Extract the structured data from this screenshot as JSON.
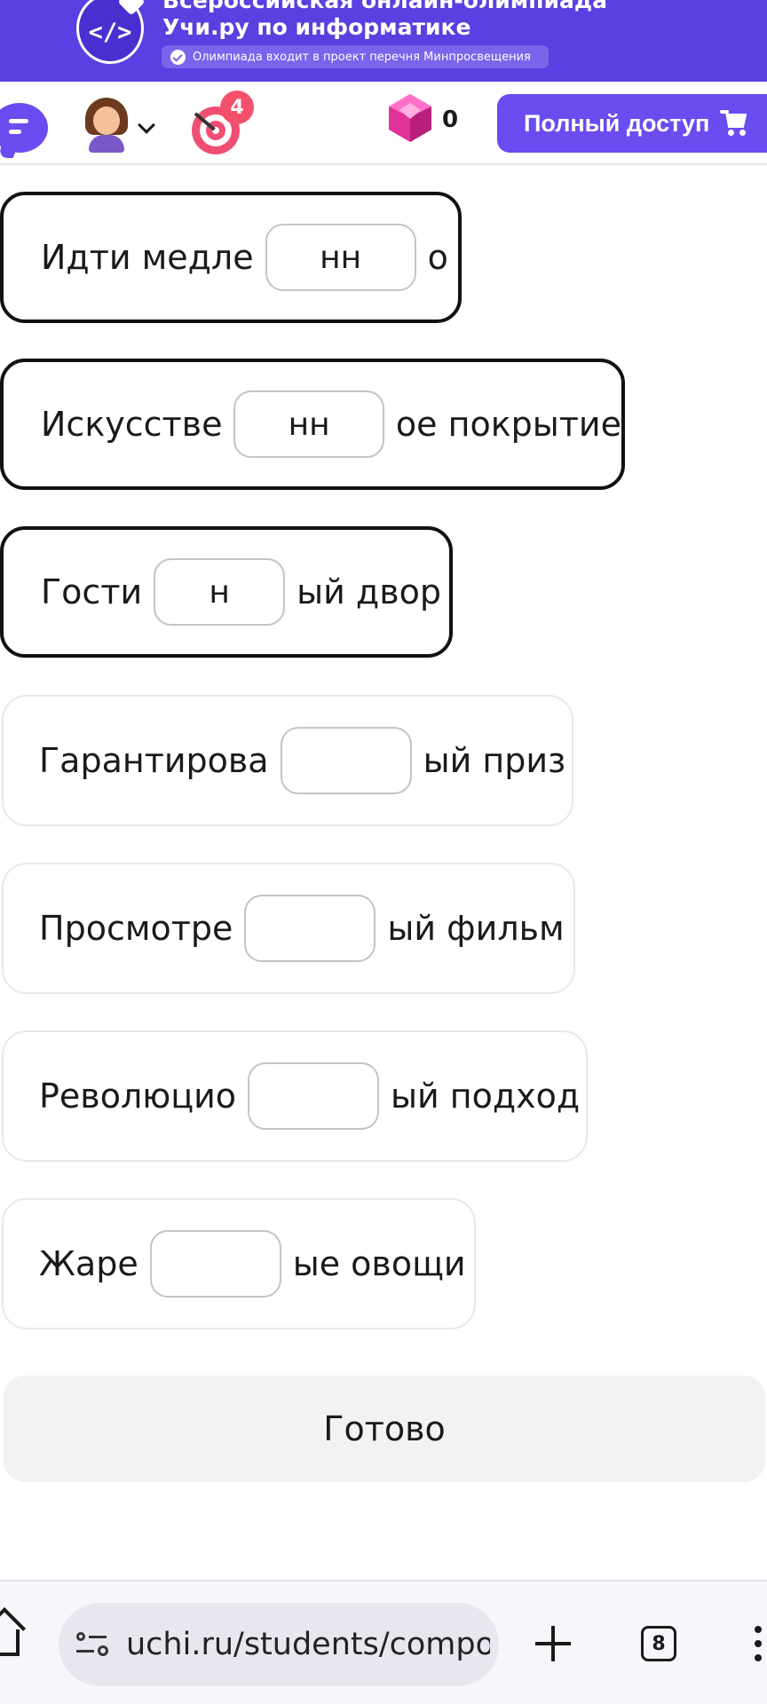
{
  "banner": {
    "title_line1": "Всероссийская онлайн-олимпиада",
    "title_line2": "Учи.ру по информатике",
    "pill_text": "Олимпиада входит в проект перечня Минпросвещения",
    "logo_code": "</>"
  },
  "header": {
    "tasks_badge": "4",
    "gems_count": "0",
    "full_access_label": "Полный доступ"
  },
  "tasks": [
    {
      "before": "Идти медле",
      "answer": "нн",
      "after": "о",
      "state": "answered"
    },
    {
      "before": "Искусстве",
      "answer": "нн",
      "after": "ое покрытие",
      "state": "answered"
    },
    {
      "before": "Гости",
      "answer": "н",
      "after": "ый двор",
      "state": "answered"
    },
    {
      "before": "Гарантирова",
      "answer": "",
      "after": "ый приз",
      "state": "empty"
    },
    {
      "before": "Просмотре",
      "answer": "",
      "after": "ый фильм",
      "state": "empty"
    },
    {
      "before": "Революцио",
      "answer": "",
      "after": "ый подход",
      "state": "empty"
    },
    {
      "before": "Жаре",
      "answer": "",
      "after": "ые овощи",
      "state": "empty"
    }
  ],
  "ready_label": "Готово",
  "browser": {
    "url": "uchi.ru/students/compo",
    "tab_count": "8"
  },
  "colors": {
    "brand_purple": "#5b3fe0",
    "button_purple": "#6a4cf0",
    "badge_red": "#f4506c"
  }
}
